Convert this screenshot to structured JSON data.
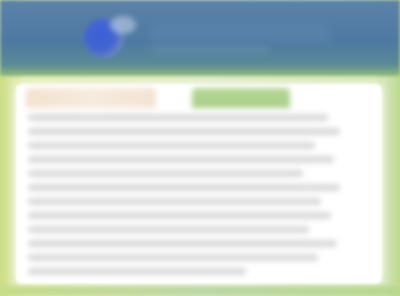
{
  "header": {
    "logo_icon": "globe-logo-icon"
  },
  "tabs": [
    {
      "id": "home"
    },
    {
      "id": "active",
      "selected": true
    }
  ],
  "colors": {
    "header_blue": "#4f79a3",
    "logo_blue": "#3a5fd6",
    "active_tab_green": "#a9cf88",
    "inactive_tab_beige": "#f3e2cf",
    "page_background_green": "#cfe08c",
    "panel_white": "#ffffff",
    "text_placeholder_gray": "#d9d9d9"
  },
  "content": {
    "line_count": 12
  }
}
